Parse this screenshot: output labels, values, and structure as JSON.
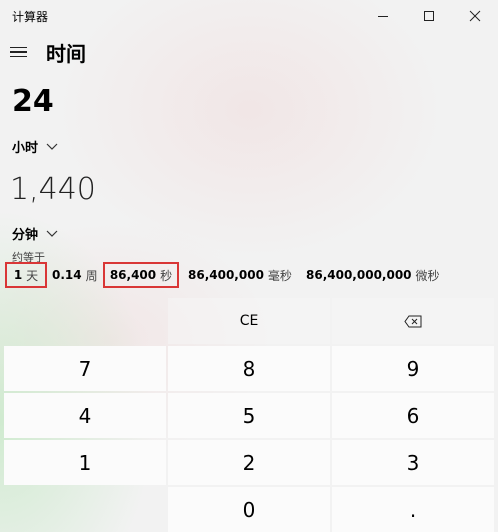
{
  "window": {
    "title": "计算器",
    "controls": {
      "minimize_icon": "minimize-icon",
      "maximize_icon": "maximize-icon",
      "close_icon": "close-icon"
    }
  },
  "header": {
    "menu_icon": "hamburger-icon",
    "mode_title": "时间"
  },
  "input": {
    "value": "24",
    "unit": "小时"
  },
  "output": {
    "value": "1,440",
    "unit": "分钟"
  },
  "equivalents": {
    "label": "约等于",
    "items": [
      {
        "value": "1",
        "unit": "天",
        "highlighted": true
      },
      {
        "value": "0.14",
        "unit": "周",
        "highlighted": false
      },
      {
        "value": "86,400",
        "unit": "秒",
        "highlighted": true
      },
      {
        "value": "86,400,000",
        "unit": "毫秒",
        "highlighted": false
      },
      {
        "value": "86,400,000,000",
        "unit": "微秒",
        "highlighted": false
      }
    ]
  },
  "keypad": {
    "ce": "CE",
    "backspace_icon": "backspace-icon",
    "digits": [
      "7",
      "8",
      "9",
      "4",
      "5",
      "6",
      "1",
      "2",
      "3",
      "0"
    ],
    "decimal": "."
  },
  "colors": {
    "highlight_border": "#d93636",
    "key_bg": "#fbfbfb"
  }
}
